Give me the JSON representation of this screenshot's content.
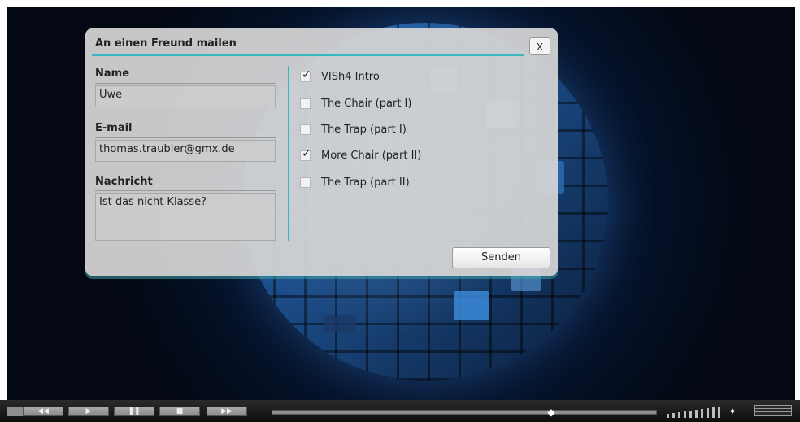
{
  "dialog": {
    "title": "An einen Freund mailen",
    "close_label": "X",
    "name_label": "Name",
    "name_value": "Uwe",
    "email_label": "E-mail",
    "email_value": "thomas.traubler@gmx.de",
    "message_label": "Nachricht",
    "message_value": "Ist das nicht Klasse?",
    "send_label": "Senden",
    "videos": [
      {
        "label": "VISh4 Intro",
        "checked": true
      },
      {
        "label": "The Chair (part I)",
        "checked": false
      },
      {
        "label": "The Trap (part I)",
        "checked": false
      },
      {
        "label": "More Chair (part II)",
        "checked": true
      },
      {
        "label": "The Trap (part II)",
        "checked": false
      }
    ]
  },
  "controls": {
    "rewind_icon": "rewind-icon",
    "play_icon": "play-icon",
    "pause_icon": "pause-icon",
    "stop_icon": "stop-icon",
    "forward_icon": "fast-forward-icon",
    "seek_icon": "seek-handle-icon",
    "volume_icon": "volume-level-icon",
    "fullscreen_icon": "fullscreen-icon"
  },
  "colors": {
    "accent": "#39b7c0",
    "dialog_bg": "#d6d6d6",
    "stage_bg": "#040814"
  }
}
